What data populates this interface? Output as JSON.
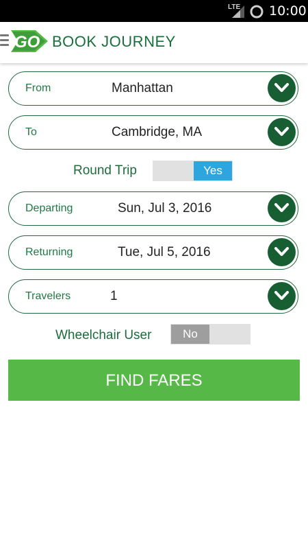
{
  "status_bar": {
    "network": "LTE",
    "time": "10:00"
  },
  "header": {
    "logo_text": "GO",
    "title": "BOOK JOURNEY"
  },
  "form": {
    "from": {
      "label": "From",
      "value": "Manhattan"
    },
    "to": {
      "label": "To",
      "value": "Cambridge, MA"
    },
    "round_trip": {
      "label": "Round Trip",
      "value": "Yes"
    },
    "departing": {
      "label": "Departing",
      "value": "Sun, Jul 3, 2016"
    },
    "returning": {
      "label": "Returning",
      "value": "Tue, Jul 5, 2016"
    },
    "travelers": {
      "label": "Travelers",
      "value": "1"
    },
    "wheelchair": {
      "label": "Wheelchair User",
      "value": "No"
    }
  },
  "find_button": {
    "label": "FIND FARES"
  },
  "colors": {
    "brand_green": "#17703c",
    "button_green": "#55b847",
    "toggle_on_blue": "#2ba6de",
    "toggle_off_gray": "#9e9e9e"
  }
}
